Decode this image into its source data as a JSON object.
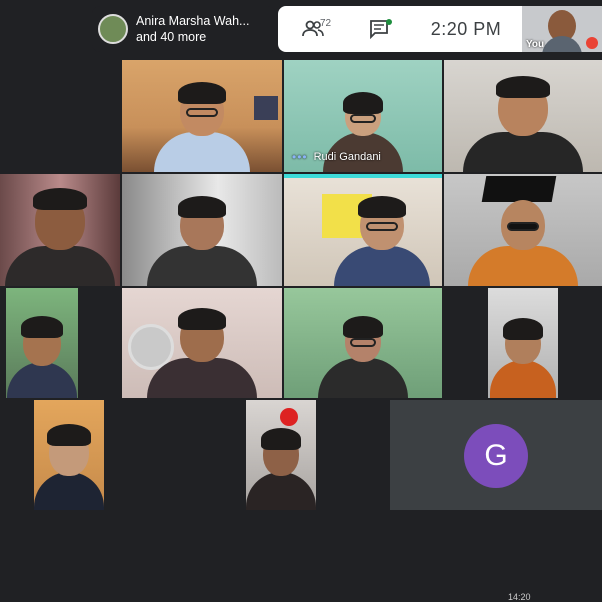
{
  "presenter": {
    "line1": "Anira Marsha Wah...",
    "line2": "and 40 more"
  },
  "toolbar": {
    "participants_count": "72",
    "time": "2:20  PM"
  },
  "self_view": {
    "label": "You"
  },
  "tiles": {
    "rudi_name": "Rudi Gandani",
    "avatar_letter": "G"
  },
  "taskbar": {
    "time_partial": "14:20"
  },
  "colors": {
    "accent_blue": "#8ab4f8",
    "avatar_purple": "#7c4dbb",
    "mic_off_red": "#ea4335",
    "background": "#202124"
  },
  "icons": [
    "people-icon",
    "chat-icon",
    "mic-off-icon"
  ]
}
